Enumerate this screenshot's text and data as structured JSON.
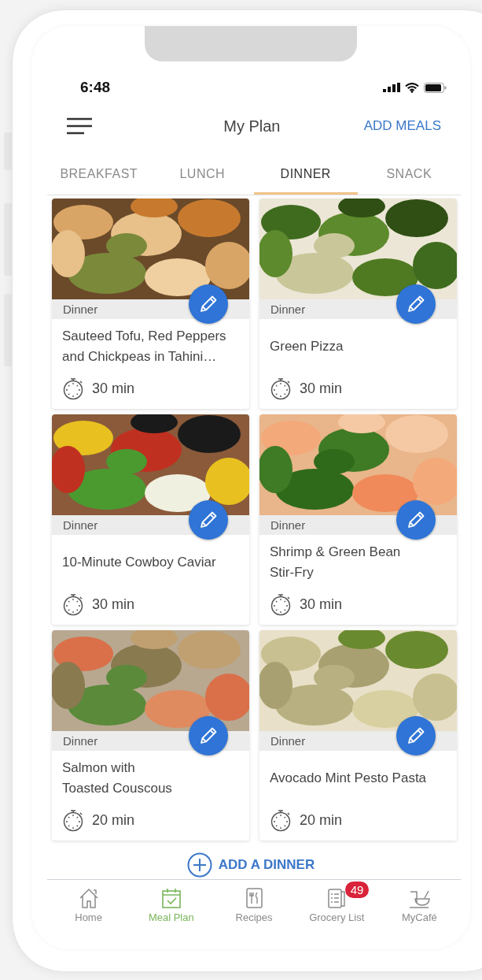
{
  "status_bar": {
    "time": "6:48"
  },
  "header": {
    "title": "My Plan",
    "action": "ADD MEALS"
  },
  "tabs": [
    {
      "label": "BREAKFAST",
      "selected": false
    },
    {
      "label": "LUNCH",
      "selected": false
    },
    {
      "label": "DINNER",
      "selected": true
    },
    {
      "label": "SNACK",
      "selected": false
    }
  ],
  "meals": [
    {
      "category": "Dinner",
      "title_lines": [
        "Sauteed Tofu, Red Peppers",
        "and Chickpeas in Tahini…"
      ],
      "time": "30 min"
    },
    {
      "category": "Dinner",
      "title_lines": [
        "Green Pizza"
      ],
      "time": "30 min"
    },
    {
      "category": "Dinner",
      "title_lines": [
        "10-Minute Cowboy Caviar"
      ],
      "time": "30 min"
    },
    {
      "category": "Dinner",
      "title_lines": [
        "Shrimp & Green Bean",
        "Stir-Fry"
      ],
      "time": "30 min"
    },
    {
      "category": "Dinner",
      "title_lines": [
        "Salmon with",
        "Toasted Couscous"
      ],
      "time": "20 min"
    },
    {
      "category": "Dinner",
      "title_lines": [
        "Avocado Mint Pesto Pasta"
      ],
      "time": "20 min"
    }
  ],
  "add_button": "ADD A DINNER",
  "nav": [
    {
      "label": "Home",
      "selected": false
    },
    {
      "label": "Meal Plan",
      "selected": true
    },
    {
      "label": "Recipes",
      "selected": false
    },
    {
      "label": "Grocery List",
      "selected": false,
      "badge": "49"
    },
    {
      "label": "MyCafé",
      "selected": false
    }
  ]
}
